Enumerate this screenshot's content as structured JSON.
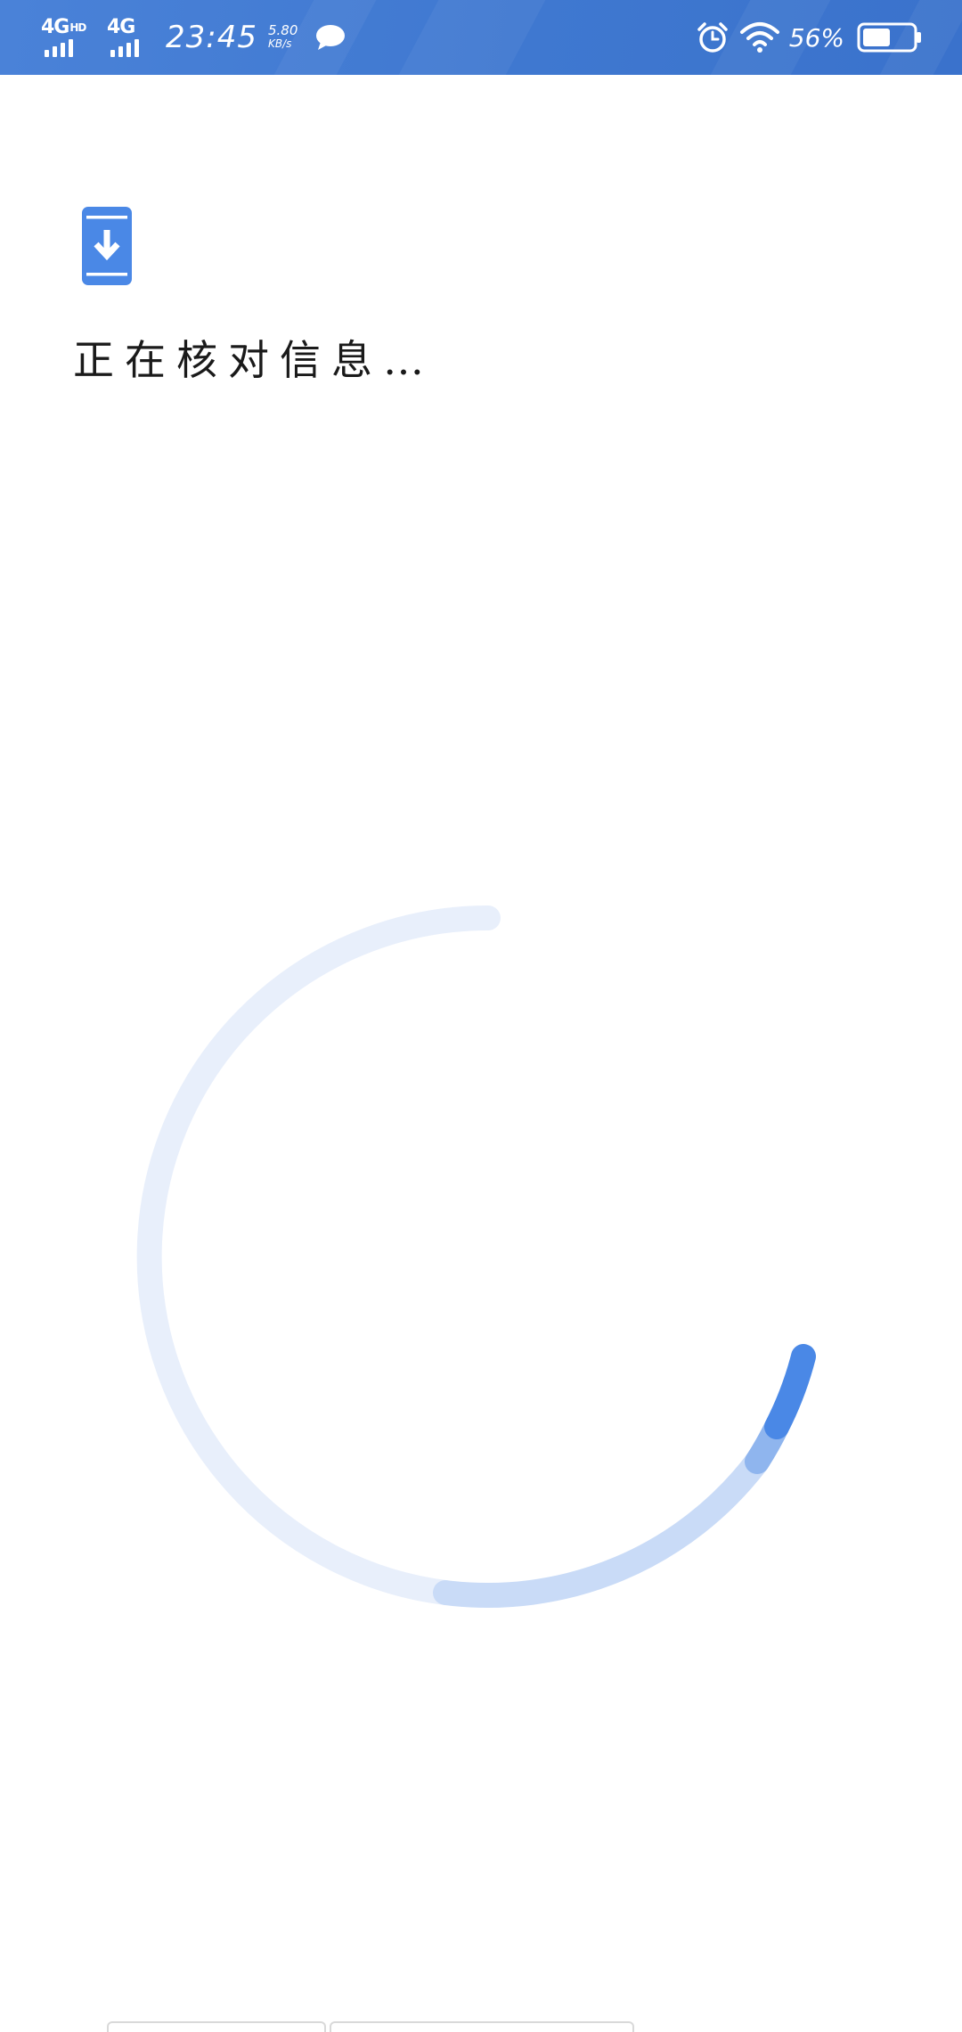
{
  "status_bar": {
    "network_1": "4G",
    "network_1_badge": "HD",
    "network_2": "4G",
    "time": "23:45",
    "speed_value": "5.80",
    "speed_unit": "KB/s",
    "battery_percent": "56%",
    "battery_level": 0.56,
    "icons": [
      "message-icon",
      "alarm-icon",
      "wifi-icon",
      "battery-icon"
    ]
  },
  "main": {
    "title": "正在核对信息…",
    "icon": "phone-download-icon"
  },
  "spinner": {
    "icon": "loading-spinner-icon"
  },
  "colors": {
    "status_bar": "#3f78d0",
    "accent": "#4a88e6",
    "spinner_track": "#e8effb",
    "spinner_mid": "#c9dbf7"
  }
}
